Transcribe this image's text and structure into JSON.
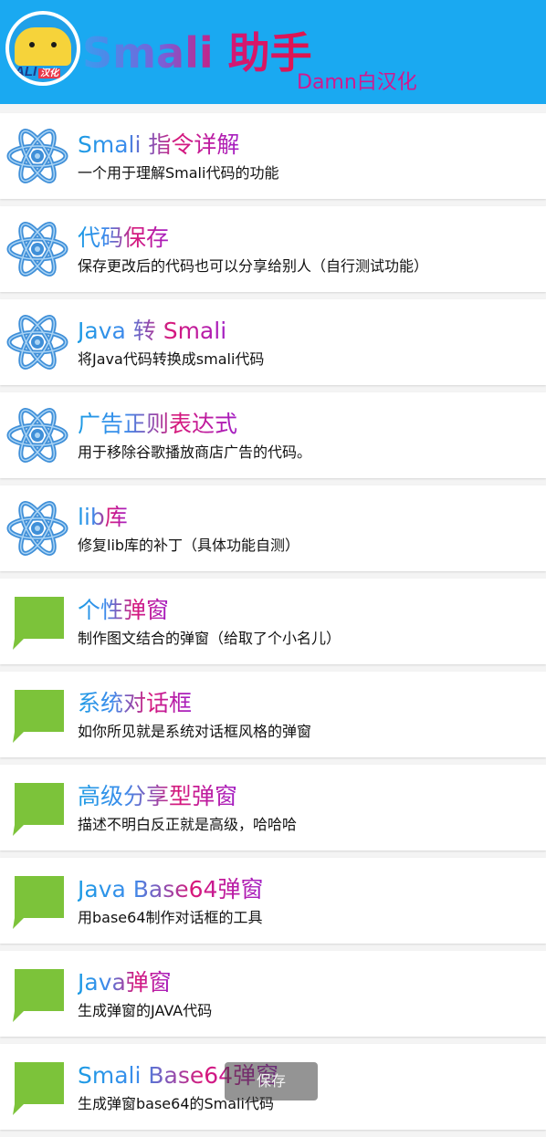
{
  "header": {
    "title": "Smali 助手",
    "subtitle": "Damn白汉化",
    "logo_text": "ALI",
    "logo_badge": "汉化"
  },
  "items": [
    {
      "title": "Smali 指令详解",
      "desc": "一个用于理解Smali代码的功能",
      "icon": "atom-icon"
    },
    {
      "title": "代码保存",
      "desc": "保存更改后的代码也可以分享给别人（自行测试功能）",
      "icon": "atom-icon"
    },
    {
      "title": "Java 转 Smali",
      "desc": "将Java代码转换成smali代码",
      "icon": "atom-icon"
    },
    {
      "title": "广告正则表达式",
      "desc": "用于移除谷歌播放商店广告的代码。",
      "icon": "atom-icon"
    },
    {
      "title": "lib库",
      "desc": "修复lib库的补丁（具体功能自测）",
      "icon": "atom-icon"
    },
    {
      "title": "个性弹窗",
      "desc": "制作图文结合的弹窗（给取了个小名儿）",
      "icon": "chat-bubble-icon"
    },
    {
      "title": "系统对话框",
      "desc": "如你所见就是系统对话框风格的弹窗",
      "icon": "chat-bubble-icon"
    },
    {
      "title": "高级分享型弹窗",
      "desc": "描述不明白反正就是高级，哈哈哈",
      "icon": "chat-bubble-icon"
    },
    {
      "title": "Java Base64弹窗",
      "desc": "用base64制作对话框的工具",
      "icon": "chat-bubble-icon"
    },
    {
      "title": "Java弹窗",
      "desc": "生成弹窗的JAVA代码",
      "icon": "chat-bubble-icon"
    },
    {
      "title": "Smali Base64弹窗",
      "desc": "生成弹窗base64的Smali代码",
      "icon": "chat-bubble-icon"
    }
  ],
  "toast": {
    "text": "保存"
  },
  "colors": {
    "header_bg": "#1aa9f1",
    "atom_blue": "#3f8fd8",
    "bubble_green": "#7cc33a"
  }
}
